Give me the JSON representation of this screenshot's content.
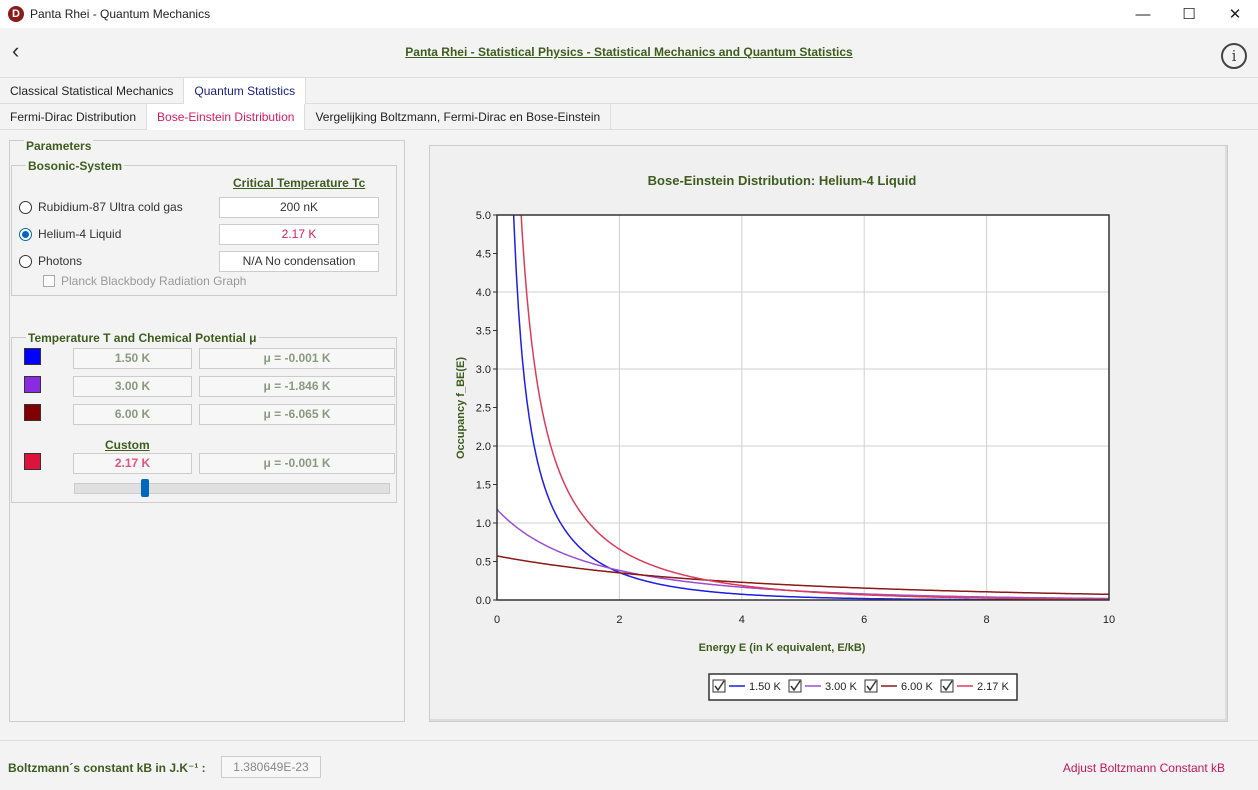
{
  "window": {
    "title": "Panta Rhei - Quantum Mechanics",
    "logo_letter": "D"
  },
  "header": {
    "title": "Panta Rhei - Statistical Physics - Statistical Mechanics and Quantum Statistics",
    "info": "i"
  },
  "tabs_main": [
    {
      "label": "Classical Statistical Mechanics"
    },
    {
      "label": "Quantum Statistics"
    }
  ],
  "tabs_sub": [
    {
      "label": "Fermi-Dirac Distribution"
    },
    {
      "label": "Bose-Einstein Distribution"
    },
    {
      "label": "Vergelijking Boltzmann, Fermi-Dirac en Bose-Einstein"
    }
  ],
  "params": {
    "title": "Parameters",
    "bosonic_title": "Bosonic-System",
    "crit_header": "Critical Temperature Tc",
    "systems": [
      {
        "label": "Rubidium-87 Ultra cold gas",
        "tc": "200 nK",
        "checked": false
      },
      {
        "label": "Helium-4 Liquid",
        "tc": "2.17 K",
        "checked": true
      },
      {
        "label": "Photons",
        "tc": "N/A No condensation",
        "checked": false
      }
    ],
    "planck_label": "Planck Blackbody Radiation Graph",
    "temp_title": "Temperature T and Chemical Potential μ",
    "temps": [
      {
        "T": "1.50 K",
        "mu": "μ = -0.001 K",
        "color": "#0000ff"
      },
      {
        "T": "3.00 K",
        "mu": "μ = -1.846 K",
        "color": "#8a2be2"
      },
      {
        "T": "6.00 K",
        "mu": "μ = -6.065 K",
        "color": "#800000"
      }
    ],
    "custom_header": "Custom",
    "custom": {
      "T": "2.17 K",
      "mu": "μ = -0.001 K",
      "color": "#dc143c"
    }
  },
  "footer": {
    "label": "Boltzmann´s constant kB in J.K⁻¹ :",
    "value": "1.380649E-23",
    "link": "Adjust Boltzmann Constant kB"
  },
  "chart_data": {
    "type": "line",
    "title": "Bose-Einstein Distribution: Helium-4 Liquid",
    "xlabel": "Energy E (in K equivalent, E/kB)",
    "ylabel": "Occupancy f_BE(E)",
    "xlim": [
      0,
      10
    ],
    "ylim": [
      0,
      5
    ],
    "x_ticks": [
      "0",
      "2",
      "4",
      "6",
      "8",
      "10"
    ],
    "y_ticks": [
      "0.0",
      "0.5",
      "1.0",
      "1.5",
      "2.0",
      "2.5",
      "3.0",
      "3.5",
      "4.0",
      "4.5",
      "5.0"
    ],
    "grid": true,
    "legend_position": "bottom-center",
    "series": [
      {
        "name": "1.50 K",
        "color": "#1e1ee6",
        "T": 1.5,
        "mu": -0.001
      },
      {
        "name": "3.00 K",
        "color": "#9c4fd6",
        "T": 3.0,
        "mu": -1.846
      },
      {
        "name": "6.00 K",
        "color": "#8b1a1a",
        "T": 6.0,
        "mu": -6.065
      },
      {
        "name": "2.17 K",
        "color": "#dc3c5a",
        "T": 2.17,
        "mu": -0.001
      }
    ]
  }
}
